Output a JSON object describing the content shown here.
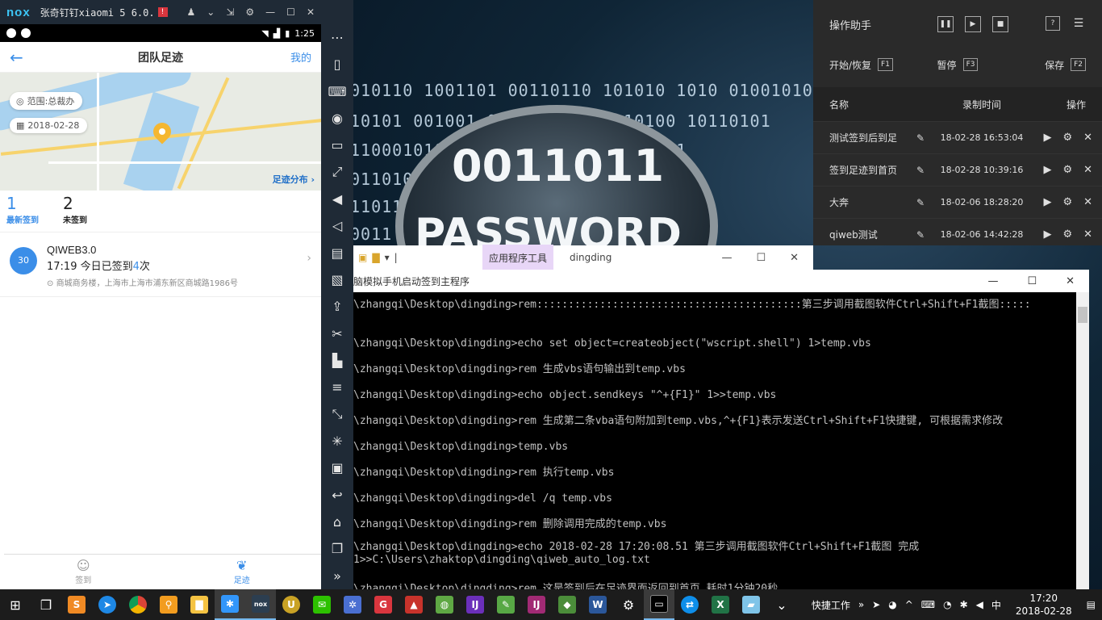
{
  "nox": {
    "logo": "nox",
    "title": "张奇钉钉xiaomi 5 6.0.",
    "badge": "!",
    "status_time": "1:25",
    "app": {
      "back": "←",
      "title": "团队足迹",
      "mine": "我的"
    },
    "map": {
      "scope": "范围:总裁办",
      "date": "2018-02-28",
      "distribution": "足迹分布"
    },
    "stats": {
      "signed_count": "1",
      "signed_label": "最新签到",
      "unsigned_count": "2",
      "unsigned_label": "未签到"
    },
    "record": {
      "avatar": "30",
      "name": "QIWEB3.0",
      "time": "17:19",
      "text_prefix": "今日已签到",
      "count": "4",
      "text_suffix": "次",
      "address": "商城商务楼，上海市上海市浦东新区商城路1986号"
    },
    "tabs": [
      {
        "label": "签到"
      },
      {
        "label": "足迹"
      }
    ]
  },
  "wallpaper": {
    "binary_lines": [
      "010110 1001101 00110110 101010 1010 010010101 010010",
      "10101 001001 001          10010 10010100 10110101",
      "110001010                  10110011 10010010 1001",
      "0110100                        101011101 010010",
      "110111                          010011 1001 0100",
      "0011                              10 010101011"
    ],
    "lens_digits": "0011011",
    "lens_word": "PASSWORD"
  },
  "helper": {
    "title": "操作助手",
    "start_label": "开始/恢复",
    "start_key": "F1",
    "pause_label": "暂停",
    "pause_key": "F3",
    "save_label": "保存",
    "save_key": "F2",
    "col_name": "名称",
    "col_time": "录制时间",
    "col_ops": "操作",
    "rows": [
      {
        "name": "测试签到后到足",
        "time": "18-02-28 16:53:04"
      },
      {
        "name": "签到足迹到首页",
        "time": "18-02-28 10:39:16"
      },
      {
        "name": "大奔",
        "time": "18-02-06 18:28:20"
      },
      {
        "name": "qiweb测试",
        "time": "18-02-06 14:42:28"
      }
    ]
  },
  "explorer": {
    "app_tools": "应用程序工具",
    "folder": "dingding"
  },
  "cmd": {
    "title": "脑模拟手机启动签到主程序",
    "lines": [
      "\\zhangqi\\Desktop\\dingding>rem::::::::::::::::::::::::::::::::::::::::::第三步调用截图软件Ctrl+Shift+F1截图:::::",
      "",
      "\\zhangqi\\Desktop\\dingding>echo set object=createobject(\"wscript.shell\") 1>temp.vbs",
      "\\zhangqi\\Desktop\\dingding>rem  生成vbs语句输出到temp.vbs",
      "\\zhangqi\\Desktop\\dingding>echo object.sendkeys \"^+{F1}\" 1>>temp.vbs",
      "\\zhangqi\\Desktop\\dingding>rem 生成第二条vba语句附加到temp.vbs,^+{F1}表示发送Ctrl+Shift+F1快捷键, 可根据需求修改",
      "\\zhangqi\\Desktop\\dingding>temp.vbs",
      "\\zhangqi\\Desktop\\dingding>rem 执行temp.vbs",
      "\\zhangqi\\Desktop\\dingding>del /q temp.vbs",
      "\\zhangqi\\Desktop\\dingding>rem 删除调用完成的temp.vbs",
      "\\zhangqi\\Desktop\\dingding>echo 2018-02-28 17:20:08.51  第三步调用截图软件Ctrl+Shift+F1截图 完成  1>>C:\\Users\\zhaktop\\dingding\\qiweb_auto_log.txt",
      "\\zhangqi\\Desktop\\dingding>rem 这是签到后在足迹界面返回到首页 耗时1分钟20秒"
    ]
  },
  "taskbar": {
    "quick_label": "快捷工作",
    "ime": "中",
    "time": "17:20",
    "date": "2018-02-28"
  }
}
